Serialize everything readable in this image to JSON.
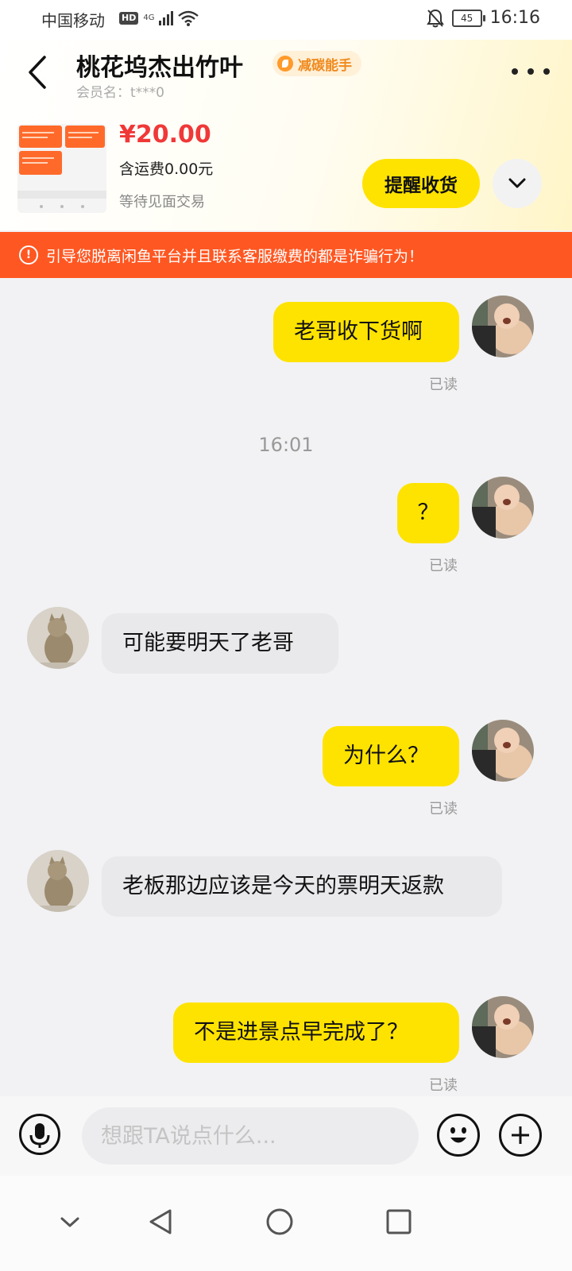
{
  "status_bar": {
    "carrier": "中国移动",
    "hd": "HD",
    "network": "4G",
    "battery": "45",
    "time": "16:16"
  },
  "header": {
    "title": "桃花坞杰出竹叶",
    "badge": "减碳能手",
    "member": "会员名：t***0"
  },
  "item": {
    "price": "¥20.00",
    "shipping": "含运费0.00元",
    "status": "等待见面交易",
    "remind_button": "提醒收货"
  },
  "warning": {
    "text": "引导您脱离闲鱼平台并且联系客服缴费的都是诈骗行为！"
  },
  "messages": [
    {
      "side": "out",
      "text": "老哥收下货啊",
      "read": "已读"
    },
    {
      "timestamp": "16:01"
    },
    {
      "side": "out",
      "text": "？",
      "read": "已读"
    },
    {
      "side": "in",
      "text": "可能要明天了老哥"
    },
    {
      "side": "out",
      "text": "为什么？",
      "read": "已读"
    },
    {
      "side": "in",
      "text": "老板那边应该是今天的票明天返款"
    },
    {
      "side": "out",
      "text": "不是进景点早完成了？",
      "read": "已读"
    }
  ],
  "input": {
    "placeholder": "想跟TA说点什么..."
  },
  "colors": {
    "accent_yellow": "#ffe300",
    "price_red": "#f03838",
    "warning_orange": "#ff5722",
    "badge_orange": "#f08a1e"
  }
}
